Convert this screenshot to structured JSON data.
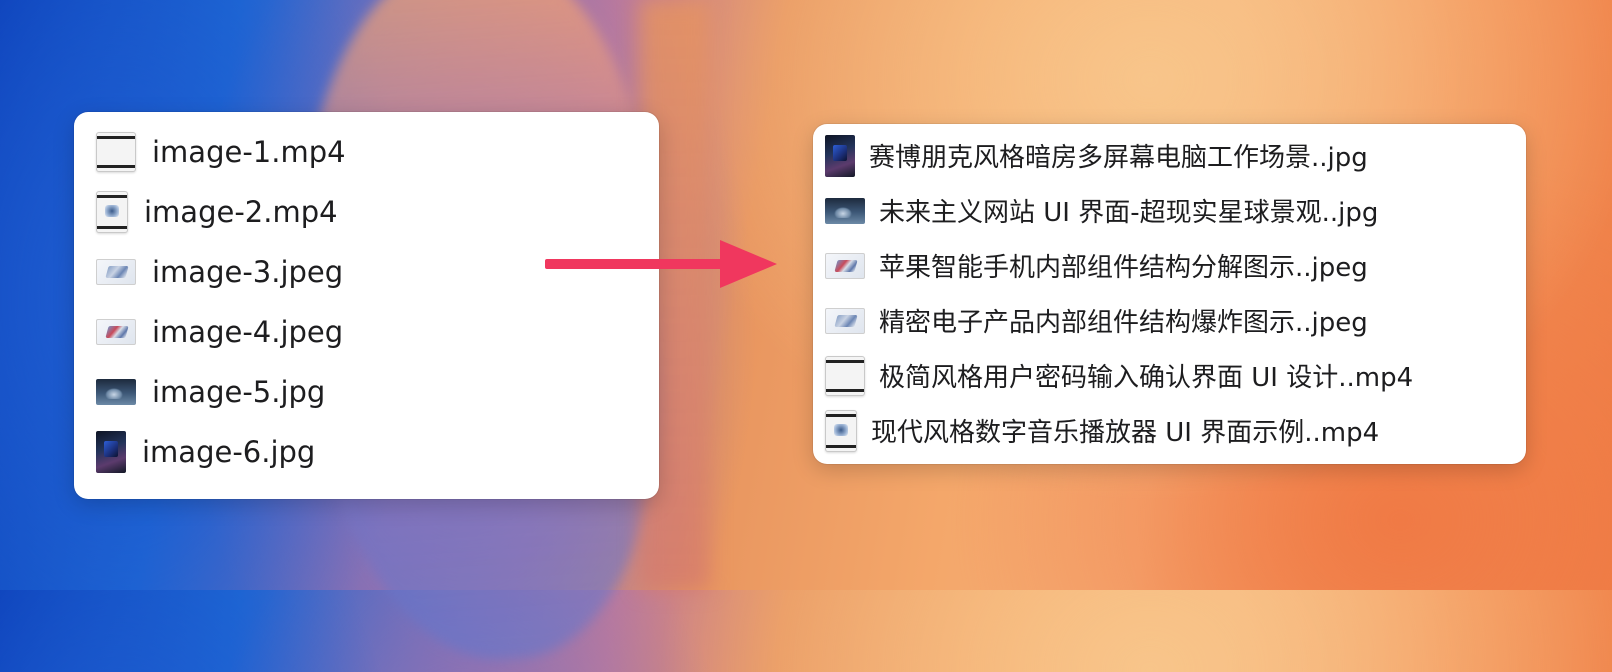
{
  "before_list": {
    "items": [
      {
        "name": "image-1.mp4",
        "icon": "video-thumbnail-icon"
      },
      {
        "name": "image-2.mp4",
        "icon": "video-thumbnail-icon"
      },
      {
        "name": "image-3.jpeg",
        "icon": "image-thumbnail-icon"
      },
      {
        "name": "image-4.jpeg",
        "icon": "image-thumbnail-icon"
      },
      {
        "name": "image-5.jpg",
        "icon": "image-thumbnail-icon"
      },
      {
        "name": "image-6.jpg",
        "icon": "image-thumbnail-icon"
      }
    ]
  },
  "after_list": {
    "items": [
      {
        "name": "赛博朋克风格暗房多屏幕电脑工作场景..jpg",
        "icon": "image-thumbnail-icon"
      },
      {
        "name": "未来主义网站 UI 界面-超现实星球景观..jpg",
        "icon": "image-thumbnail-icon"
      },
      {
        "name": "苹果智能手机内部组件结构分解图示..jpeg",
        "icon": "image-thumbnail-icon"
      },
      {
        "name": "精密电子产品内部组件结构爆炸图示..jpeg",
        "icon": "image-thumbnail-icon"
      },
      {
        "name": "极简风格用户密码输入确认界面 UI 设计..mp4",
        "icon": "video-thumbnail-icon"
      },
      {
        "name": "现代风格数字音乐播放器 UI 界面示例..mp4",
        "icon": "video-thumbnail-icon"
      }
    ]
  },
  "arrow": {
    "color": "#f0375e",
    "icon": "arrow-right-icon"
  }
}
